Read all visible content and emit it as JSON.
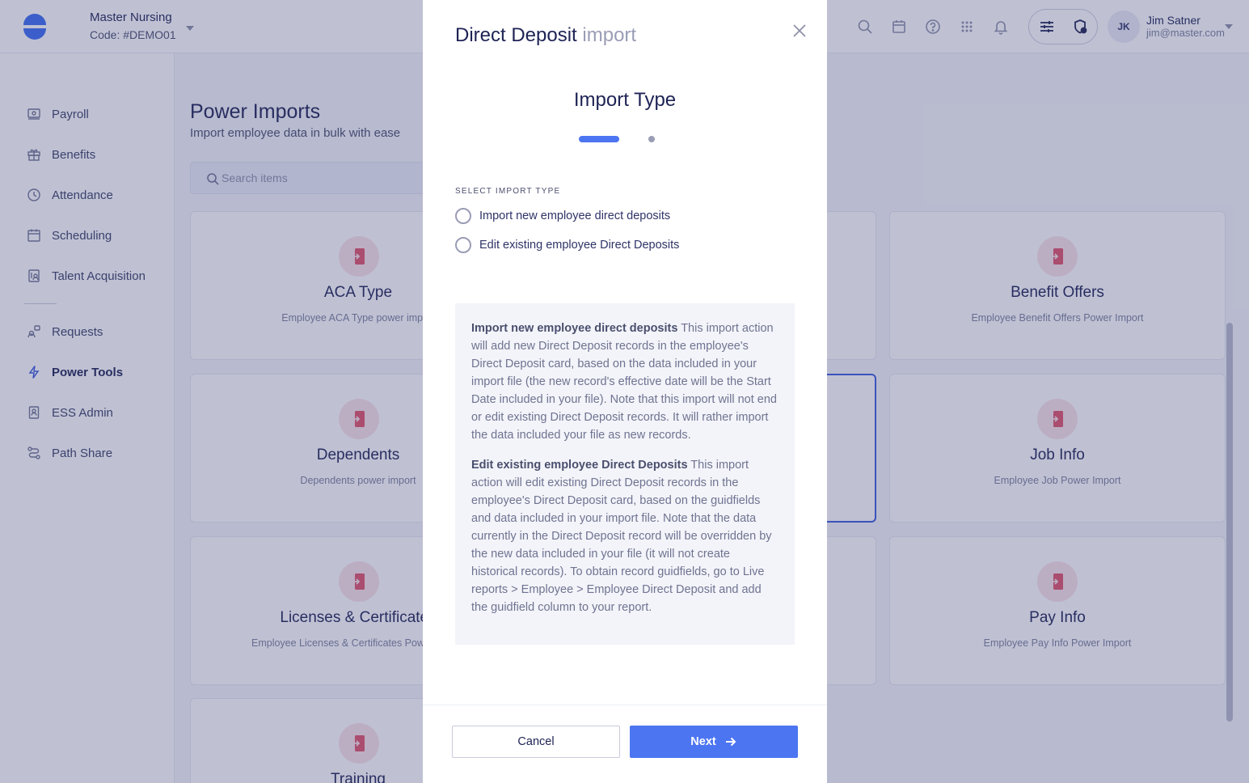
{
  "header": {
    "org_name": "Master Nursing",
    "org_code": "Code: #DEMO01",
    "user_initials": "JK",
    "user_name": "Jim Satner",
    "user_email": "jim@master.com",
    "icons": [
      "search-icon",
      "calendar-icon",
      "help-icon",
      "apps-grid-icon",
      "bell-icon",
      "sliders-icon",
      "shield-settings-icon"
    ]
  },
  "sidebar": {
    "items": [
      {
        "label": "Payroll",
        "icon": "payroll-icon"
      },
      {
        "label": "Benefits",
        "icon": "gift-icon"
      },
      {
        "label": "Attendance",
        "icon": "clock-icon"
      },
      {
        "label": "Scheduling",
        "icon": "calendar-icon"
      },
      {
        "label": "Talent Acquisition",
        "icon": "clipboard-user-icon"
      },
      {
        "label": "Requests",
        "icon": "requests-icon"
      },
      {
        "label": "Power Tools",
        "icon": "lightning-icon",
        "active": true
      },
      {
        "label": "ESS Admin",
        "icon": "badge-icon"
      },
      {
        "label": "Path Share",
        "icon": "path-icon"
      }
    ]
  },
  "main": {
    "title": "Power Imports",
    "subtitle": "Import employee data in bulk with ease",
    "search_placeholder": "Search items",
    "cards": [
      {
        "title": "ACA Type",
        "desc": "Employee ACA Type power import"
      },
      {
        "title": "Benefit Offers",
        "desc": "Employee Benefit Offers Power Import"
      },
      {
        "title": "Dependents",
        "desc": "Dependents power import"
      },
      {
        "title": "Job Info",
        "desc": "Employee Job Power Import"
      },
      {
        "title": "Licenses & Certificates",
        "desc": "Employee Licenses & Certificates Power Import"
      },
      {
        "title": "Pay Info",
        "desc": "Employee Pay Info Power Import"
      },
      {
        "title": "Training",
        "desc": ""
      }
    ]
  },
  "modal": {
    "title_main": "Direct Deposit",
    "title_accent": "import",
    "step_title": "Import Type",
    "section_label": "SELECT IMPORT TYPE",
    "options": [
      "Import new employee direct deposits",
      "Edit existing employee Direct Deposits"
    ],
    "info": [
      {
        "heading": "Import new employee direct deposits",
        "body": " This import action will add new Direct Deposit records in the employee's Direct Deposit card, based on the data included in your import file (the new record's effective date will be the Start Date included in your file). Note that this import will not end or edit existing Direct Deposit records. It will rather import the data included your file as new records."
      },
      {
        "heading": "Edit existing employee Direct Deposits",
        "body": " This import action will edit existing Direct Deposit records in the employee's Direct Deposit card, based on the guidfields and data included in your import file. Note that the data currently in the Direct Deposit record will be overridden by the new data included in your file (it will not create historical records). To obtain record guidfields, go to Live reports > Employee > Employee Direct Deposit and add the guidfield column to your report."
      }
    ],
    "cancel_label": "Cancel",
    "next_label": "Next"
  },
  "colors": {
    "primary": "#4c75f2",
    "text_dark": "#1e2354",
    "card_icon_bg": "#fbe3e6",
    "card_icon_fg": "#e0526a",
    "overlay": "rgba(62,66,120,0.33)"
  }
}
